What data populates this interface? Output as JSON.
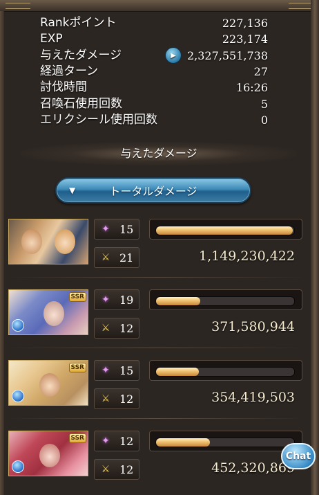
{
  "stats": [
    {
      "label": "Rankポイント",
      "value": "227,136"
    },
    {
      "label": "EXP",
      "value": "223,174"
    },
    {
      "label": "与えたダメージ",
      "value": "2,327,551,738",
      "has_play_button": true
    },
    {
      "label": "経過ターン",
      "value": "27"
    },
    {
      "label": "討伐時間",
      "value": "16:26"
    },
    {
      "label": "召喚石使用回数",
      "value": "5"
    },
    {
      "label": "エリクシール使用回数",
      "value": "0"
    }
  ],
  "section_title": "与えたダメージ",
  "damage_toggle": {
    "label": "トータルダメージ",
    "icon": "triangle-down-icon"
  },
  "characters": [
    {
      "portrait": "main-character-pair-portrait",
      "rarity": "",
      "crit_count": "15",
      "attack_count": "21",
      "damage": "1,149,230,422",
      "damage_fraction": 0.99
    },
    {
      "portrait": "blue-haired-character-portrait",
      "rarity": "SSR",
      "crit_count": "19",
      "attack_count": "12",
      "damage": "371,580,944",
      "damage_fraction": 0.32
    },
    {
      "portrait": "blonde-character-portrait",
      "rarity": "SSR",
      "crit_count": "15",
      "attack_count": "12",
      "damage": "354,419,503",
      "damage_fraction": 0.31
    },
    {
      "portrait": "red-haired-character-portrait",
      "rarity": "SSR",
      "crit_count": "12",
      "attack_count": "12",
      "damage": "452,320,869",
      "damage_fraction": 0.39
    }
  ],
  "chat_button": {
    "label": "Chat"
  },
  "colors": {
    "bar_fill": "#f0c070",
    "button_blue": "#3d8ab8",
    "background": "#2c2622"
  }
}
